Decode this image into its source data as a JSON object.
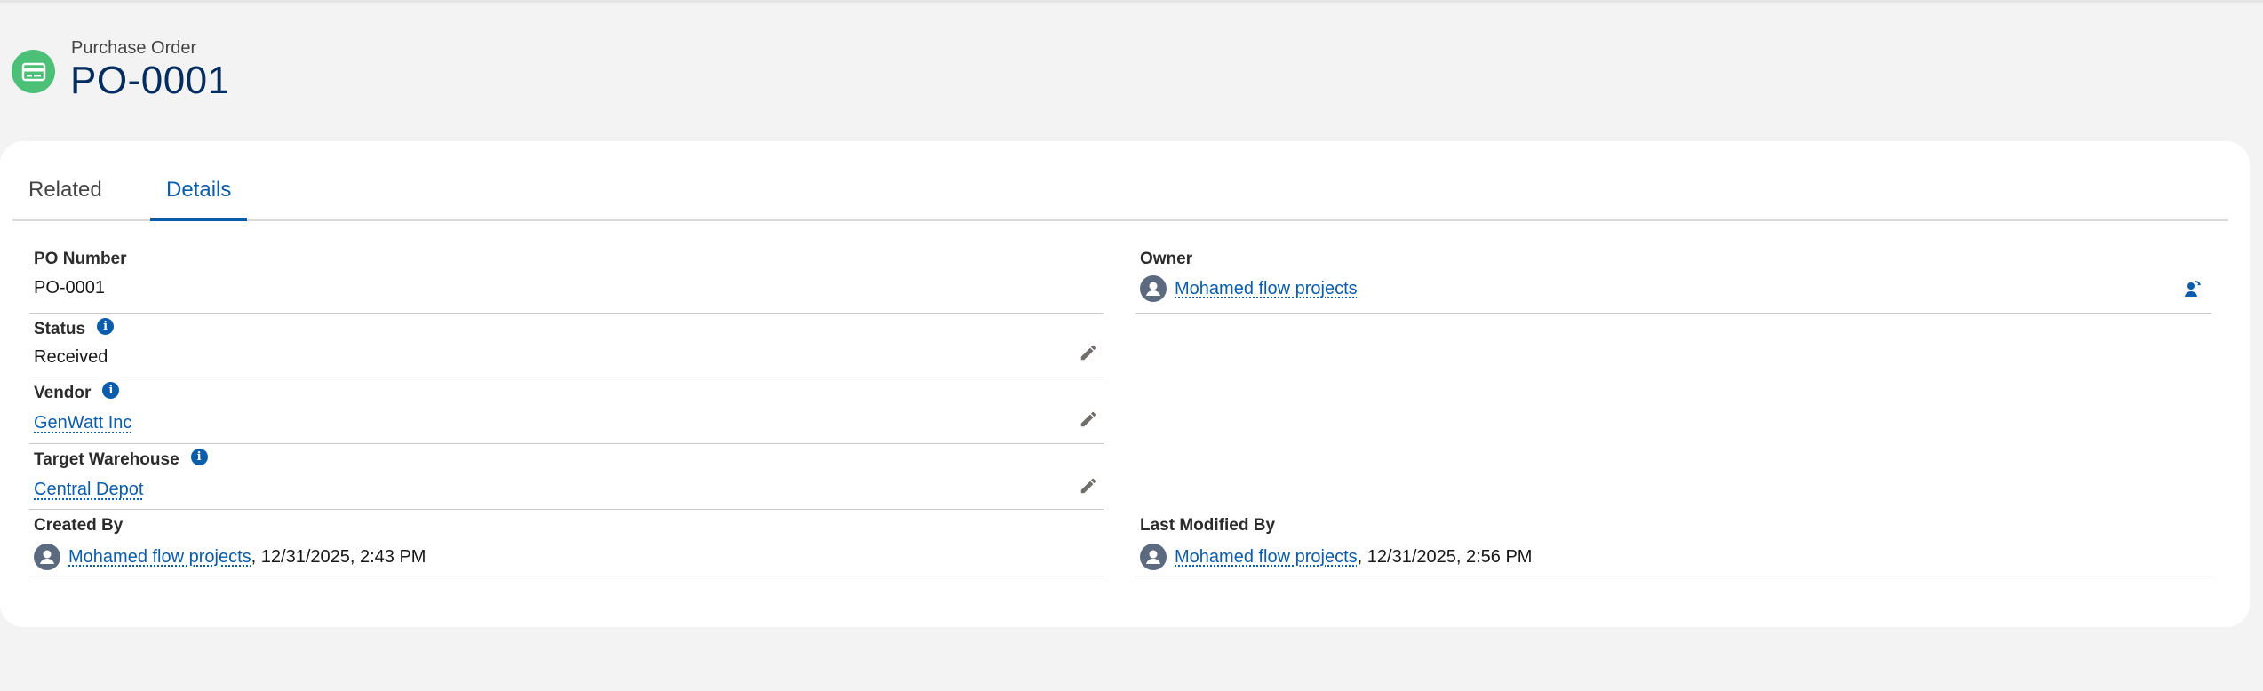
{
  "header": {
    "object_type": "Purchase Order",
    "record_name": "PO-0001",
    "icon": "purchase-order-card-icon",
    "icon_color": "#4bc076"
  },
  "tabs": [
    {
      "label": "Related",
      "active": false
    },
    {
      "label": "Details",
      "active": true
    }
  ],
  "details": {
    "po_number": {
      "label": "PO Number",
      "value": "PO-0001"
    },
    "status": {
      "label": "Status",
      "value": "Received"
    },
    "vendor": {
      "label": "Vendor",
      "value": "GenWatt Inc"
    },
    "target_warehouse": {
      "label": "Target Warehouse",
      "value": "Central Depot"
    },
    "created_by": {
      "label": "Created By",
      "user": "Mohamed flow projects",
      "date": ", 12/31/2025, 2:43 PM"
    },
    "owner": {
      "label": "Owner",
      "user": "Mohamed flow projects"
    },
    "last_modified_by": {
      "label": "Last Modified By",
      "user": "Mohamed flow projects",
      "date": ", 12/31/2025, 2:56 PM"
    }
  },
  "colors": {
    "link": "#0b5cab",
    "title": "#032d60",
    "active_tab": "#0b5cab"
  }
}
